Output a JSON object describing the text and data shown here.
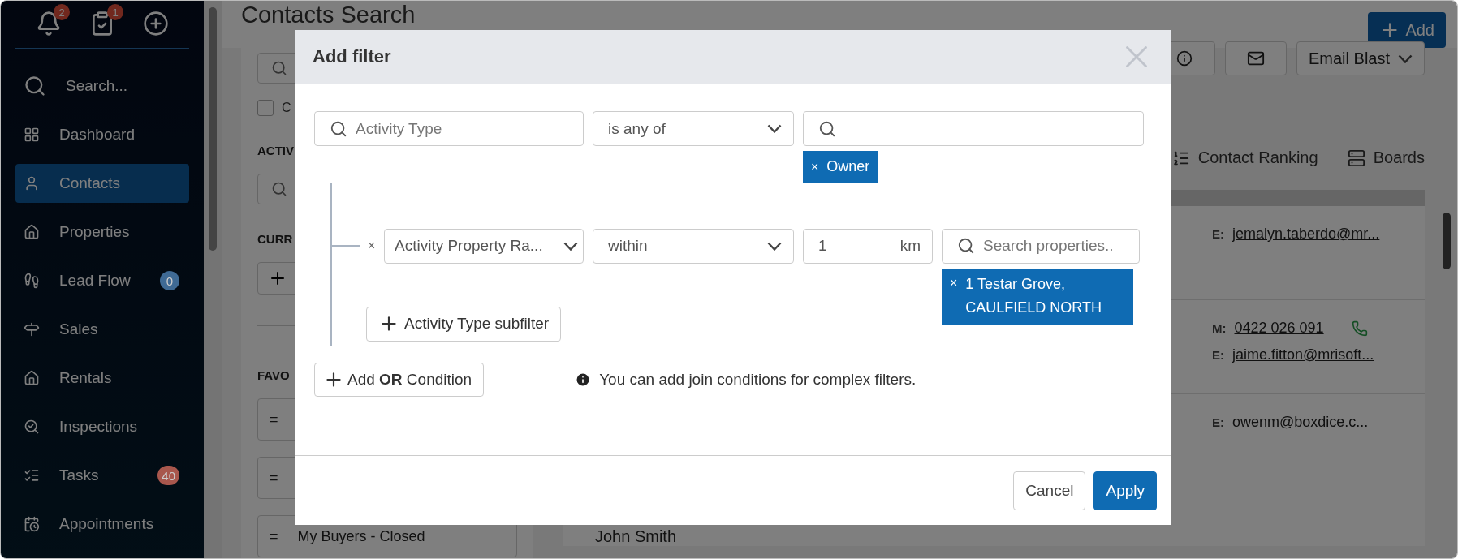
{
  "sidebar": {
    "top_icons": [
      {
        "badge": "2"
      },
      {
        "badge": "1"
      }
    ],
    "items": [
      {
        "label": "Search...",
        "selected": false
      },
      {
        "label": "Dashboard",
        "selected": false
      },
      {
        "label": "Contacts",
        "selected": true
      },
      {
        "label": "Properties",
        "selected": false
      },
      {
        "label": "Lead Flow",
        "selected": false,
        "badge": "0",
        "color": "#3f6a94"
      },
      {
        "label": "Sales",
        "selected": false
      },
      {
        "label": "Rentals",
        "selected": false
      },
      {
        "label": "Inspections",
        "selected": false
      },
      {
        "label": "Tasks",
        "selected": false,
        "badge": "40",
        "color": "#a8574d"
      },
      {
        "label": "Appointments",
        "selected": false
      }
    ]
  },
  "page": {
    "title": "Contacts Search",
    "add_button": "Add"
  },
  "left_panel": {
    "checkbox": {
      "label": "C",
      "checked": false
    },
    "headings": [
      "ACTIV",
      "CURR",
      "FAVO"
    ],
    "favorites": [
      {
        "handle": "="
      },
      {
        "handle": "="
      },
      {
        "handle": "=",
        "label": "My Buyers - Closed"
      }
    ]
  },
  "toolbar": {
    "email_blast": "Email Blast"
  },
  "views": [
    {
      "label": "Contact Ranking"
    },
    {
      "label": "Boards"
    }
  ],
  "contacts": [
    {
      "lines": [
        {
          "prefix": "E:",
          "value": "jemalyn.taberdo@mr..."
        }
      ]
    },
    {
      "lines": [
        {
          "prefix": "M:",
          "value": "0422 026 091",
          "phone": true
        },
        {
          "prefix": "E:",
          "value": "jaime.fitton@mrisoft..."
        }
      ]
    },
    {
      "lines": [
        {
          "prefix": "E:",
          "value": "owenm@boxdice.c..."
        }
      ]
    },
    {
      "name": "John Smith"
    }
  ],
  "modal": {
    "title": "Add filter",
    "filter": {
      "field": {
        "placeholder": "Activity Type"
      },
      "operator": "is any of",
      "tags": [
        {
          "remove": "×",
          "label": "Owner"
        }
      ],
      "subfilters": [
        {
          "remove": "×",
          "field": "Activity Property Ra...",
          "operator": "within",
          "distance": "1",
          "unit": "km",
          "search": {
            "placeholder": "Search properties.."
          },
          "tags": [
            {
              "remove": "×",
              "label": "1 Testar Grove, CAULFIELD NORTH"
            }
          ]
        }
      ],
      "add_subfilter": "Activity Type subfilter"
    },
    "add_or": "Add **OR** Condition",
    "info": "You can add join conditions for complex filters.",
    "buttons": [
      {
        "label": "Cancel",
        "kind": "secondary"
      },
      {
        "label": "Apply",
        "kind": "primary"
      }
    ]
  }
}
